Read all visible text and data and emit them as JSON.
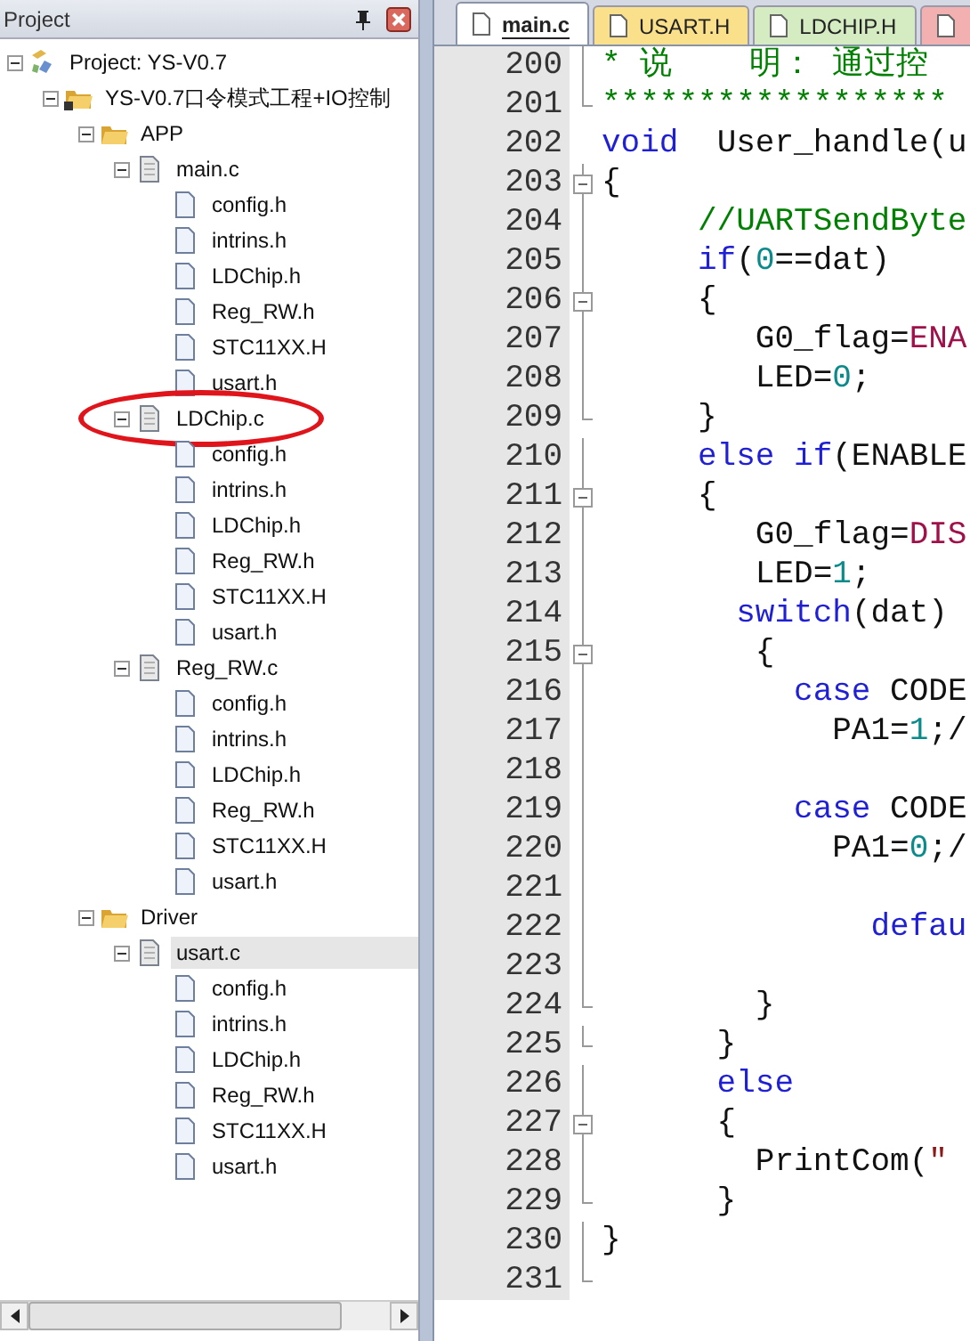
{
  "project_panel": {
    "title": "Project",
    "tree": [
      {
        "label": "Project: YS-V0.7",
        "kind": "project",
        "expanded": true,
        "selected": false,
        "children": [
          {
            "label": "YS-V0.7口令模式工程+IO控制",
            "kind": "target",
            "expanded": true,
            "selected": false,
            "children": [
              {
                "label": "APP",
                "kind": "folder",
                "expanded": true,
                "selected": false,
                "children": [
                  {
                    "label": "main.c",
                    "kind": "source",
                    "expanded": true,
                    "selected": false,
                    "children": [
                      {
                        "label": "config.h",
                        "kind": "header",
                        "selected": false
                      },
                      {
                        "label": "intrins.h",
                        "kind": "header",
                        "selected": false
                      },
                      {
                        "label": "LDChip.h",
                        "kind": "header",
                        "selected": false
                      },
                      {
                        "label": "Reg_RW.h",
                        "kind": "header",
                        "selected": false
                      },
                      {
                        "label": "STC11XX.H",
                        "kind": "header",
                        "selected": false
                      },
                      {
                        "label": "usart.h",
                        "kind": "header",
                        "selected": false
                      }
                    ]
                  },
                  {
                    "label": "LDChip.c",
                    "kind": "source",
                    "expanded": true,
                    "selected": false,
                    "circled": true,
                    "children": [
                      {
                        "label": "config.h",
                        "kind": "header",
                        "selected": false
                      },
                      {
                        "label": "intrins.h",
                        "kind": "header",
                        "selected": false
                      },
                      {
                        "label": "LDChip.h",
                        "kind": "header",
                        "selected": false
                      },
                      {
                        "label": "Reg_RW.h",
                        "kind": "header",
                        "selected": false
                      },
                      {
                        "label": "STC11XX.H",
                        "kind": "header",
                        "selected": false
                      },
                      {
                        "label": "usart.h",
                        "kind": "header",
                        "selected": false
                      }
                    ]
                  },
                  {
                    "label": "Reg_RW.c",
                    "kind": "source",
                    "expanded": true,
                    "selected": false,
                    "children": [
                      {
                        "label": "config.h",
                        "kind": "header",
                        "selected": false
                      },
                      {
                        "label": "intrins.h",
                        "kind": "header",
                        "selected": false
                      },
                      {
                        "label": "LDChip.h",
                        "kind": "header",
                        "selected": false
                      },
                      {
                        "label": "Reg_RW.h",
                        "kind": "header",
                        "selected": false
                      },
                      {
                        "label": "STC11XX.H",
                        "kind": "header",
                        "selected": false
                      },
                      {
                        "label": "usart.h",
                        "kind": "header",
                        "selected": false
                      }
                    ]
                  }
                ]
              },
              {
                "label": "Driver",
                "kind": "folder",
                "expanded": true,
                "selected": false,
                "children": [
                  {
                    "label": "usart.c",
                    "kind": "source",
                    "expanded": true,
                    "selected": true,
                    "children": [
                      {
                        "label": "config.h",
                        "kind": "header",
                        "selected": false
                      },
                      {
                        "label": "intrins.h",
                        "kind": "header",
                        "selected": false
                      },
                      {
                        "label": "LDChip.h",
                        "kind": "header",
                        "selected": false
                      },
                      {
                        "label": "Reg_RW.h",
                        "kind": "header",
                        "selected": false
                      },
                      {
                        "label": "STC11XX.H",
                        "kind": "header",
                        "selected": false
                      },
                      {
                        "label": "usart.h",
                        "kind": "header",
                        "selected": false
                      }
                    ]
                  }
                ]
              }
            ]
          }
        ]
      }
    ]
  },
  "editor": {
    "tabs": [
      {
        "label": "main.c",
        "selected": true,
        "color": "#ffffff"
      },
      {
        "label": "USART.H",
        "selected": false,
        "color": "#fbe08c"
      },
      {
        "label": "LDCHIP.H",
        "selected": false,
        "color": "#d5ebc2"
      },
      {
        "selected": false,
        "color": "#f3b0b0"
      }
    ],
    "lines": [
      {
        "number": "200",
        "kind": "code",
        "tokens": [
          {
            "kind": "comment",
            "text": "* 说    明： 通过控"
          }
        ]
      },
      {
        "number": "201",
        "kind": "block_end",
        "tokens": [
          {
            "kind": "comment",
            "text": "******************"
          }
        ]
      },
      {
        "number": "202",
        "kind": "plain",
        "tokens": [
          {
            "kind": "keyword",
            "text": "void"
          },
          {
            "kind": "plain",
            "text": "  User_handle(u"
          }
        ]
      },
      {
        "number": "203",
        "kind": "fold_start",
        "tokens": [
          {
            "kind": "plain",
            "text": "{"
          }
        ]
      },
      {
        "number": "204",
        "kind": "code",
        "tokens": [
          {
            "kind": "comment",
            "text": "     //UARTSendByte"
          }
        ]
      },
      {
        "number": "205",
        "kind": "code",
        "tokens": [
          {
            "kind": "keyword",
            "text": "     if"
          },
          {
            "kind": "plain",
            "text": "("
          },
          {
            "kind": "number",
            "text": "0"
          },
          {
            "kind": "plain",
            "text": "==dat)"
          }
        ]
      },
      {
        "number": "206",
        "kind": "fold_start",
        "tokens": [
          {
            "kind": "plain",
            "text": "     {"
          }
        ]
      },
      {
        "number": "207",
        "kind": "code",
        "tokens": [
          {
            "kind": "plain",
            "text": "        G0_flag="
          },
          {
            "kind": "constant",
            "text": "ENA"
          }
        ]
      },
      {
        "number": "208",
        "kind": "code",
        "tokens": [
          {
            "kind": "plain",
            "text": "        LED="
          },
          {
            "kind": "number",
            "text": "0"
          },
          {
            "kind": "plain",
            "text": ";"
          }
        ]
      },
      {
        "number": "209",
        "kind": "block_end",
        "tokens": [
          {
            "kind": "plain",
            "text": "     }"
          }
        ]
      },
      {
        "number": "210",
        "kind": "code",
        "tokens": [
          {
            "kind": "keyword",
            "text": "     else if"
          },
          {
            "kind": "plain",
            "text": "(ENABLE"
          }
        ]
      },
      {
        "number": "211",
        "kind": "fold_start",
        "tokens": [
          {
            "kind": "plain",
            "text": "     {"
          }
        ]
      },
      {
        "number": "212",
        "kind": "code",
        "tokens": [
          {
            "kind": "plain",
            "text": "        G0_flag="
          },
          {
            "kind": "constant",
            "text": "DIS"
          }
        ]
      },
      {
        "number": "213",
        "kind": "code",
        "tokens": [
          {
            "kind": "plain",
            "text": "        LED="
          },
          {
            "kind": "number",
            "text": "1"
          },
          {
            "kind": "plain",
            "text": ";"
          }
        ]
      },
      {
        "number": "214",
        "kind": "code",
        "tokens": [
          {
            "kind": "keyword",
            "text": "       switch"
          },
          {
            "kind": "plain",
            "text": "(dat)"
          }
        ]
      },
      {
        "number": "215",
        "kind": "fold_start",
        "tokens": [
          {
            "kind": "plain",
            "text": "        {"
          }
        ]
      },
      {
        "number": "216",
        "kind": "code",
        "tokens": [
          {
            "kind": "keyword",
            "text": "          case"
          },
          {
            "kind": "plain",
            "text": " CODE"
          }
        ]
      },
      {
        "number": "217",
        "kind": "code",
        "tokens": [
          {
            "kind": "plain",
            "text": "            PA1="
          },
          {
            "kind": "number",
            "text": "1"
          },
          {
            "kind": "plain",
            "text": ";/"
          }
        ]
      },
      {
        "number": "218",
        "kind": "code"
      },
      {
        "number": "219",
        "kind": "code",
        "tokens": [
          {
            "kind": "keyword",
            "text": "          case"
          },
          {
            "kind": "plain",
            "text": " CODE"
          }
        ]
      },
      {
        "number": "220",
        "kind": "code",
        "tokens": [
          {
            "kind": "plain",
            "text": "            PA1="
          },
          {
            "kind": "number",
            "text": "0"
          },
          {
            "kind": "plain",
            "text": ";/"
          }
        ]
      },
      {
        "number": "221",
        "kind": "code"
      },
      {
        "number": "222",
        "kind": "code",
        "tokens": [
          {
            "kind": "keyword",
            "text": "              defau"
          }
        ]
      },
      {
        "number": "223",
        "kind": "code"
      },
      {
        "number": "224",
        "kind": "block_end",
        "tokens": [
          {
            "kind": "plain",
            "text": "        }"
          }
        ]
      },
      {
        "number": "225",
        "kind": "block_end",
        "tokens": [
          {
            "kind": "plain",
            "text": "      }"
          }
        ]
      },
      {
        "number": "226",
        "kind": "code",
        "tokens": [
          {
            "kind": "keyword",
            "text": "      else"
          }
        ]
      },
      {
        "number": "227",
        "kind": "fold_start",
        "tokens": [
          {
            "kind": "plain",
            "text": "      {"
          }
        ]
      },
      {
        "number": "228",
        "kind": "code",
        "tokens": [
          {
            "kind": "plain",
            "text": "        PrintCom("
          },
          {
            "kind": "string",
            "text": "\""
          }
        ]
      },
      {
        "number": "229",
        "kind": "block_end",
        "tokens": [
          {
            "kind": "plain",
            "text": "      }"
          }
        ]
      },
      {
        "number": "230",
        "kind": "code",
        "tokens": [
          {
            "kind": "plain",
            "text": "}"
          }
        ]
      },
      {
        "number": "231",
        "kind": "block_end"
      }
    ]
  }
}
